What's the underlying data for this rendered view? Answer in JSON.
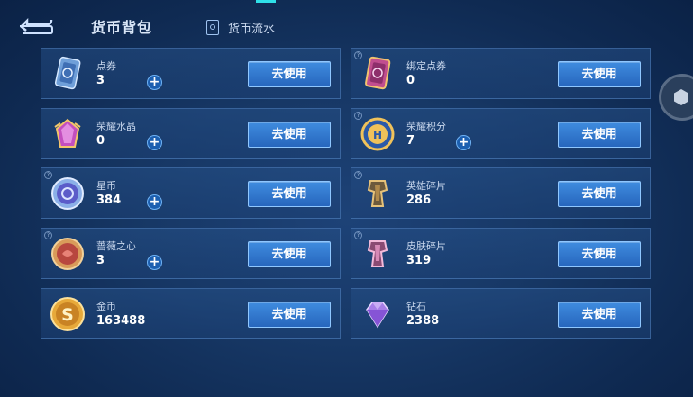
{
  "header": {
    "title": "货币背包",
    "flow_label": "货币流水"
  },
  "buttons": {
    "use_label": "去使用"
  },
  "items": [
    {
      "name": "点券",
      "count": "3",
      "has_plus": true,
      "icon": "coupon-card-icon"
    },
    {
      "name": "绑定点券",
      "count": "0",
      "has_plus": false,
      "icon": "bound-coupon-card-icon"
    },
    {
      "name": "荣耀水晶",
      "count": "0",
      "has_plus": true,
      "icon": "glory-crystal-icon"
    },
    {
      "name": "荣耀积分",
      "count": "7",
      "has_plus": true,
      "icon": "glory-points-icon"
    },
    {
      "name": "星币",
      "count": "384",
      "has_plus": true,
      "icon": "star-coin-icon"
    },
    {
      "name": "英雄碎片",
      "count": "286",
      "has_plus": false,
      "icon": "hero-fragment-icon"
    },
    {
      "name": "蔷薇之心",
      "count": "3",
      "has_plus": true,
      "icon": "rose-heart-icon"
    },
    {
      "name": "皮肤碎片",
      "count": "319",
      "has_plus": false,
      "icon": "skin-fragment-icon"
    },
    {
      "name": "金币",
      "count": "163488",
      "has_plus": false,
      "icon": "gold-coin-icon"
    },
    {
      "name": "钻石",
      "count": "2388",
      "has_plus": false,
      "icon": "diamond-icon"
    }
  ],
  "colors": {
    "accent": "#2fe0e8",
    "button": "#3478d0",
    "card_border": "#4f86c8"
  }
}
